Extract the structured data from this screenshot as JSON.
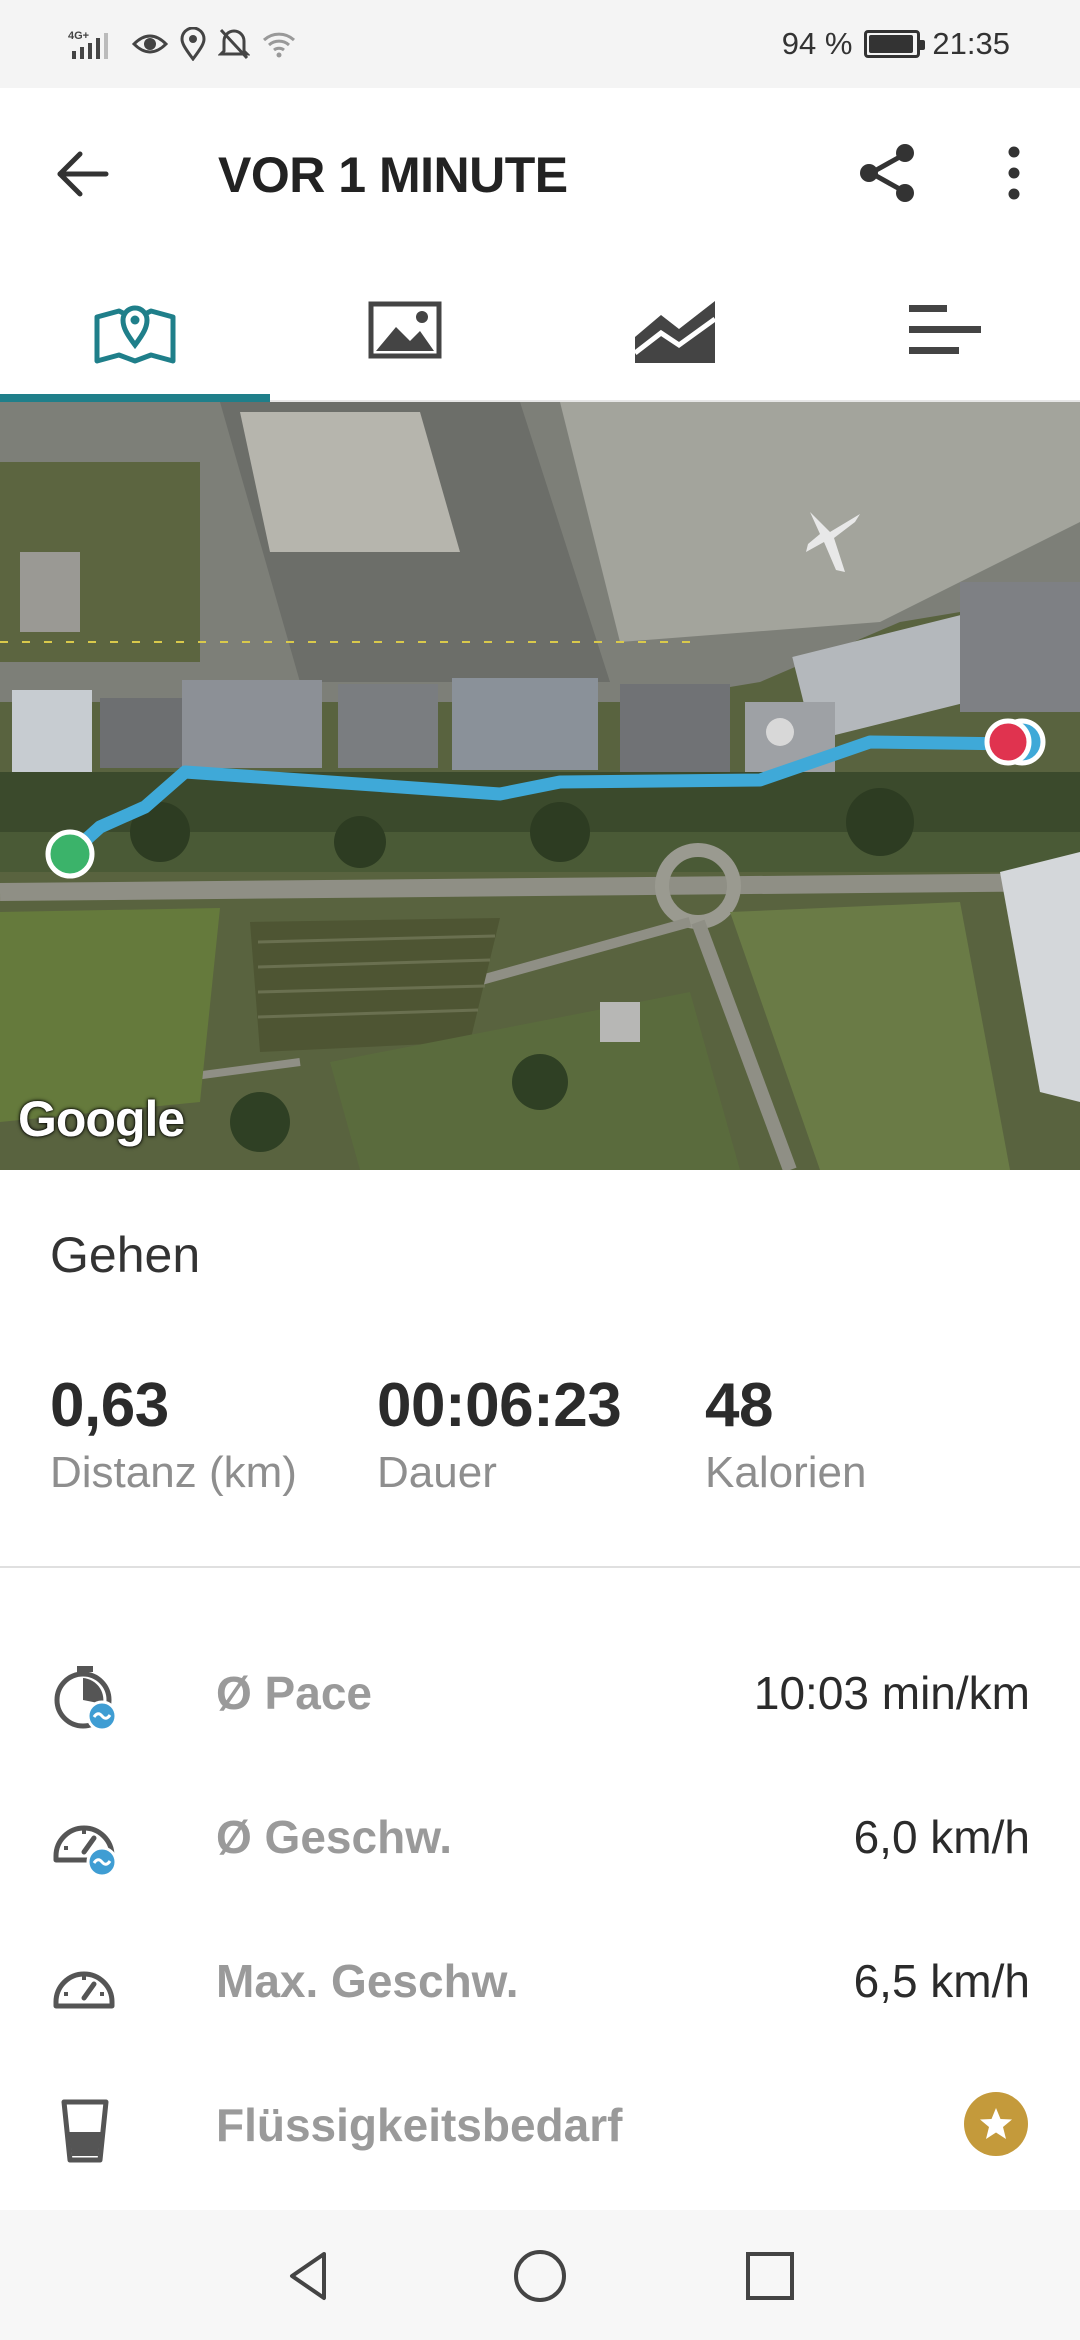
{
  "status_bar": {
    "network": "4G+",
    "battery_percent_text": "94 %",
    "battery_level": 0.94,
    "time": "21:35",
    "icons": [
      "signal-icon",
      "eye-icon",
      "location-icon",
      "mute-bell-icon",
      "wifi-icon",
      "battery-icon"
    ]
  },
  "header": {
    "title": "VOR 1 MINUTE",
    "icons": [
      "back-arrow-icon",
      "share-icon",
      "more-vertical-icon"
    ]
  },
  "tabs": [
    {
      "icon": "map-pin-icon",
      "active": true
    },
    {
      "icon": "image-icon",
      "active": false
    },
    {
      "icon": "chart-area-icon",
      "active": false
    },
    {
      "icon": "list-bars-icon",
      "active": false
    }
  ],
  "map": {
    "attribution": "Google",
    "start_marker_color": "#3bb36a",
    "end_marker_color": "#e0334f",
    "route_color": "#3fa9d8"
  },
  "activity": {
    "type": "Gehen",
    "stats": [
      {
        "value": "0,63",
        "label": "Distanz (km)"
      },
      {
        "value": "00:06:23",
        "label": "Dauer"
      },
      {
        "value": "48",
        "label": "Kalorien"
      }
    ],
    "metrics": [
      {
        "icon": "stopwatch-pace-icon",
        "label": "Ø Pace",
        "value": "10:03 min/km"
      },
      {
        "icon": "speedometer-avg-icon",
        "label": "Ø Geschw.",
        "value": "6,0 km/h"
      },
      {
        "icon": "speedometer-max-icon",
        "label": "Max. Geschw.",
        "value": "6,5 km/h"
      },
      {
        "icon": "cup-icon",
        "label": "Flüssigkeitsbedarf",
        "value_icon": "premium-star-icon"
      }
    ]
  },
  "colors": {
    "accent": "#1f7f8a",
    "premium": "#c49a3b",
    "small_badge": "#3f9dd3"
  },
  "nav": {
    "icons": [
      "nav-back-icon",
      "nav-home-icon",
      "nav-recents-icon"
    ]
  }
}
